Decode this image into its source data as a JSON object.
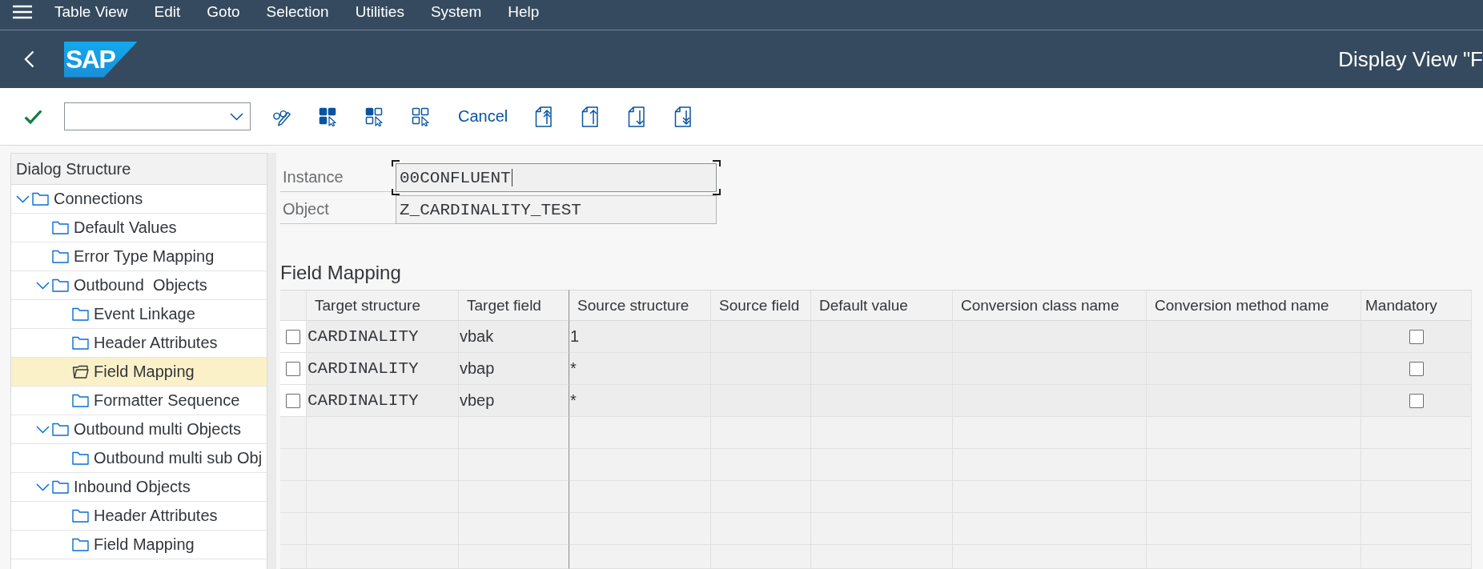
{
  "menu_bar": {
    "items": [
      "Table View",
      "Edit",
      "Goto",
      "Selection",
      "Utilities",
      "System",
      "Help"
    ]
  },
  "shell_bar": {
    "logo": "SAP",
    "title": "Display View \"F"
  },
  "toolbar": {
    "cancel_label": "Cancel"
  },
  "dialog_structure": {
    "title": "Dialog Structure",
    "tree": [
      {
        "label": "Connections",
        "expanded": true,
        "selected": false,
        "children": [
          {
            "label": "Default Values",
            "selected": false
          },
          {
            "label": "Error Type Mapping",
            "selected": false
          },
          {
            "label": "Outbound  Objects",
            "expanded": true,
            "selected": false,
            "children": [
              {
                "label": "Event Linkage",
                "selected": false
              },
              {
                "label": "Header Attributes",
                "selected": false
              },
              {
                "label": "Field Mapping",
                "selected": true
              },
              {
                "label": "Formatter Sequence",
                "selected": false
              }
            ]
          },
          {
            "label": "Outbound multi Objects",
            "expanded": true,
            "selected": false,
            "children": [
              {
                "label": "Outbound multi sub Obj",
                "selected": false
              }
            ]
          },
          {
            "label": "Inbound Objects",
            "expanded": true,
            "selected": false,
            "children": [
              {
                "label": "Header Attributes",
                "selected": false
              },
              {
                "label": "Field Mapping",
                "selected": false
              }
            ]
          }
        ]
      }
    ]
  },
  "form": {
    "fields": [
      {
        "label": "Instance",
        "value": "00CONFLUENT",
        "focused": true
      },
      {
        "label": "Object",
        "value": "Z_CARDINALITY_TEST",
        "focused": false
      }
    ]
  },
  "field_mapping": {
    "title": "Field Mapping",
    "columns": [
      "Target structure",
      "Target field",
      "Source structure",
      "Source field",
      "Default value",
      "Conversion class name",
      "Conversion method name",
      "Mandatory"
    ],
    "rows": [
      {
        "selected": false,
        "target_structure": "CARDINALITY",
        "target_field": "vbak",
        "source_structure": "1",
        "mandatory": false
      },
      {
        "selected": false,
        "target_structure": "CARDINALITY",
        "target_field": "vbap",
        "source_structure": "*",
        "mandatory": false
      },
      {
        "selected": false,
        "target_structure": "CARDINALITY",
        "target_field": "vbep",
        "source_structure": "*",
        "mandatory": false
      }
    ]
  }
}
